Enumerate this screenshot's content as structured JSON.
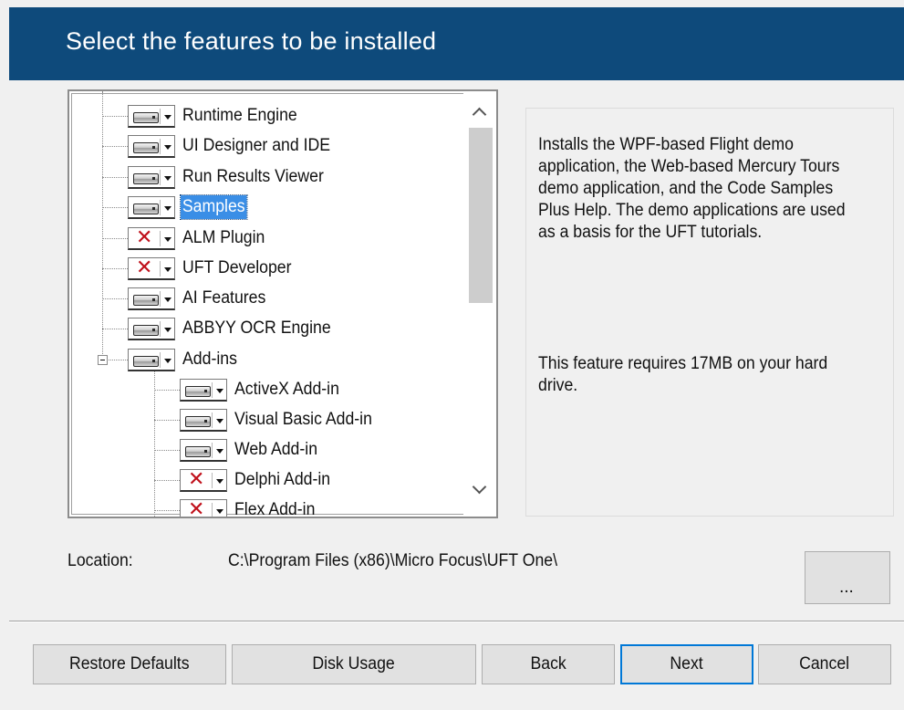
{
  "header": {
    "title": "Select the features to be installed"
  },
  "tree": {
    "items": [
      {
        "label": "Runtime Engine",
        "state": "installed"
      },
      {
        "label": "UI Designer and IDE",
        "state": "installed"
      },
      {
        "label": "Run Results Viewer",
        "state": "installed"
      },
      {
        "label": "Samples",
        "state": "installed",
        "selected": true
      },
      {
        "label": "ALM Plugin",
        "state": "not-installed"
      },
      {
        "label": "UFT Developer",
        "state": "not-installed"
      },
      {
        "label": "AI Features",
        "state": "installed"
      },
      {
        "label": "ABBYY OCR Engine",
        "state": "installed"
      },
      {
        "label": "Add-ins",
        "state": "installed",
        "expanded": true,
        "children": [
          {
            "label": "ActiveX Add-in",
            "state": "installed"
          },
          {
            "label": "Visual Basic Add-in",
            "state": "installed"
          },
          {
            "label": "Web Add-in",
            "state": "installed"
          },
          {
            "label": "Delphi Add-in",
            "state": "not-installed"
          },
          {
            "label": "Flex Add-in",
            "state": "not-installed"
          }
        ]
      }
    ]
  },
  "description": {
    "text": "Installs the WPF-based Flight demo application, the Web-based Mercury Tours demo application, and the Code Samples Plus Help. The demo applications are used as a basis for the UFT tutorials.",
    "requirement": "This feature requires 17MB on your hard drive."
  },
  "location": {
    "label": "Location:",
    "path": "C:\\Program Files (x86)\\Micro Focus\\UFT One\\",
    "browse_label": "..."
  },
  "buttons": {
    "restore_defaults": "Restore Defaults",
    "disk_usage": "Disk Usage",
    "back": "Back",
    "next": "Next",
    "cancel": "Cancel"
  },
  "colors": {
    "header_bg": "#0e4a7b",
    "selection": "#3a8ee6",
    "not_installed_x": "#c0101a",
    "default_button_border": "#0078d7"
  },
  "icons": {
    "installed": "hard-drive-icon",
    "not_installed": "red-x-icon"
  }
}
